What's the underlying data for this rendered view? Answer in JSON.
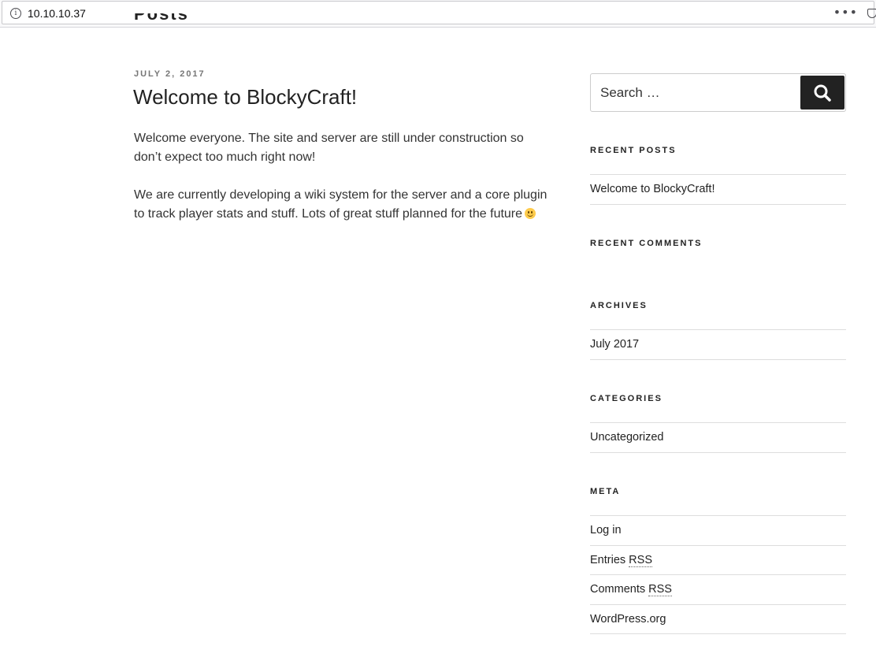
{
  "browser": {
    "url": "10.10.10.37",
    "more_glyph": "•••"
  },
  "page": {
    "clipped_heading": "Posts"
  },
  "post": {
    "date": "JULY 2, 2017",
    "title": "Welcome to BlockyCraft!",
    "paragraphs": [
      "Welcome everyone. The site and server are still under construction so don’t expect too much right now!",
      "We are currently developing a wiki system for the server and a core plugin to track player stats and stuff. Lots of great stuff planned for the future"
    ]
  },
  "sidebar": {
    "search": {
      "placeholder": "Search …"
    },
    "recent_posts": {
      "title": "RECENT POSTS",
      "items": [
        "Welcome to BlockyCraft!"
      ]
    },
    "recent_comments": {
      "title": "RECENT COMMENTS"
    },
    "archives": {
      "title": "ARCHIVES",
      "items": [
        "July 2017"
      ]
    },
    "categories": {
      "title": "CATEGORIES",
      "items": [
        "Uncategorized"
      ]
    },
    "meta": {
      "title": "META",
      "items": [
        {
          "text": "Log in",
          "abbr": ""
        },
        {
          "text": "Entries ",
          "abbr": "RSS"
        },
        {
          "text": "Comments ",
          "abbr": "RSS"
        },
        {
          "text": "WordPress.org",
          "abbr": ""
        }
      ]
    }
  },
  "colors": {
    "accent": "#222222",
    "text": "#333333",
    "meta_text": "#767676",
    "divider": "#dddddd"
  }
}
